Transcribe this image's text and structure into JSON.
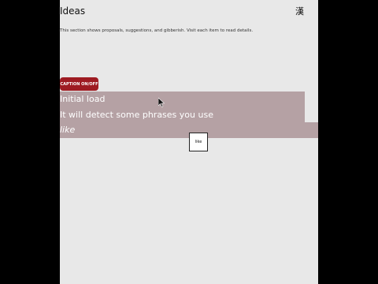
{
  "header": {
    "title": "Ideas",
    "icon": "kanji-character-icon"
  },
  "description": "This section shows proposals, suggestions, and gibberish. Visit each item to read details.",
  "caption_toggle": {
    "label": "CAPTION ON/OFF",
    "color": "#9e1b22"
  },
  "captions": {
    "line1": "Initial load",
    "line2": "It will detect some phrases you use",
    "line3": "like",
    "background": "#b5a1a4"
  },
  "popup_word": "like"
}
